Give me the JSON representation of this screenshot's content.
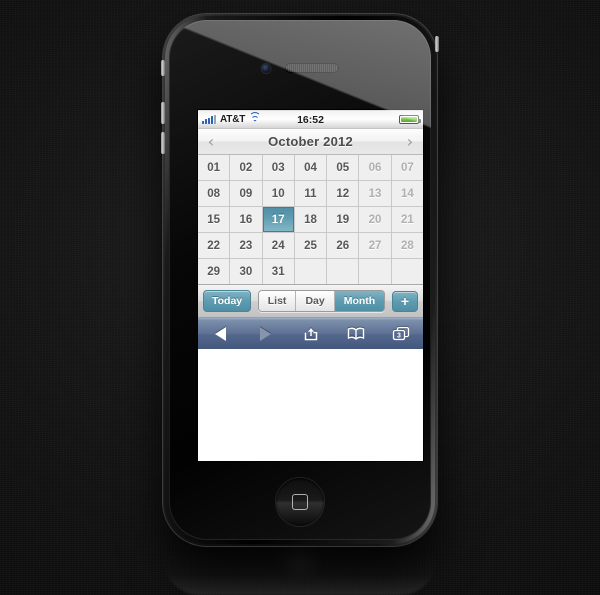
{
  "device": {
    "name": "iphone-4",
    "hardware": {
      "earpiece": "speaker-grille",
      "camera": "front-camera",
      "home_button": "home-button",
      "silent_switch": "silent-switch",
      "volume_up": "volume-up-button",
      "volume_down": "volume-down-button",
      "power": "power-button"
    }
  },
  "status_bar": {
    "carrier": "AT&T",
    "signal_icon": "signal-bars-icon",
    "signal_bars_filled": 4,
    "signal_bars_total": 5,
    "wifi_icon": "wifi-icon",
    "time": "16:52",
    "battery_icon": "battery-icon",
    "battery_level_pct": 100,
    "battery_color": "#6dc040"
  },
  "calendar": {
    "prev_label": "‹",
    "next_label": "›",
    "title": "October 2012",
    "selected_day": "17",
    "accent_color": "#5f9cb1",
    "weeks": [
      [
        {
          "label": "01",
          "dim": false,
          "selected": false
        },
        {
          "label": "02",
          "dim": false,
          "selected": false
        },
        {
          "label": "03",
          "dim": false,
          "selected": false
        },
        {
          "label": "04",
          "dim": false,
          "selected": false
        },
        {
          "label": "05",
          "dim": false,
          "selected": false
        },
        {
          "label": "06",
          "dim": true,
          "selected": false
        },
        {
          "label": "07",
          "dim": true,
          "selected": false
        }
      ],
      [
        {
          "label": "08",
          "dim": false,
          "selected": false
        },
        {
          "label": "09",
          "dim": false,
          "selected": false
        },
        {
          "label": "10",
          "dim": false,
          "selected": false
        },
        {
          "label": "11",
          "dim": false,
          "selected": false
        },
        {
          "label": "12",
          "dim": false,
          "selected": false
        },
        {
          "label": "13",
          "dim": true,
          "selected": false
        },
        {
          "label": "14",
          "dim": true,
          "selected": false
        }
      ],
      [
        {
          "label": "15",
          "dim": false,
          "selected": false
        },
        {
          "label": "16",
          "dim": false,
          "selected": false
        },
        {
          "label": "17",
          "dim": false,
          "selected": true
        },
        {
          "label": "18",
          "dim": false,
          "selected": false
        },
        {
          "label": "19",
          "dim": false,
          "selected": false
        },
        {
          "label": "20",
          "dim": true,
          "selected": false
        },
        {
          "label": "21",
          "dim": true,
          "selected": false
        }
      ],
      [
        {
          "label": "22",
          "dim": false,
          "selected": false
        },
        {
          "label": "23",
          "dim": false,
          "selected": false
        },
        {
          "label": "24",
          "dim": false,
          "selected": false
        },
        {
          "label": "25",
          "dim": false,
          "selected": false
        },
        {
          "label": "26",
          "dim": false,
          "selected": false
        },
        {
          "label": "27",
          "dim": true,
          "selected": false
        },
        {
          "label": "28",
          "dim": true,
          "selected": false
        }
      ],
      [
        {
          "label": "29",
          "dim": false,
          "selected": false
        },
        {
          "label": "30",
          "dim": false,
          "selected": false
        },
        {
          "label": "31",
          "dim": false,
          "selected": false
        },
        {
          "label": "",
          "dim": false,
          "selected": false,
          "blank": true
        },
        {
          "label": "",
          "dim": false,
          "selected": false,
          "blank": true
        },
        {
          "label": "",
          "dim": false,
          "selected": false,
          "blank": true
        },
        {
          "label": "",
          "dim": false,
          "selected": false,
          "blank": true
        }
      ]
    ]
  },
  "app_toolbar": {
    "today_label": "Today",
    "segments": [
      {
        "label": "List",
        "active": false
      },
      {
        "label": "Day",
        "active": false
      },
      {
        "label": "Month",
        "active": true
      }
    ],
    "add_label": "+"
  },
  "safari_toolbar": {
    "back_icon": "back-arrow-icon",
    "back_enabled": true,
    "forward_icon": "forward-arrow-icon",
    "forward_enabled": false,
    "share_icon": "share-icon",
    "bookmarks_icon": "bookmarks-book-icon",
    "tabs_icon": "tabs-icon",
    "tabs_count": "3"
  }
}
